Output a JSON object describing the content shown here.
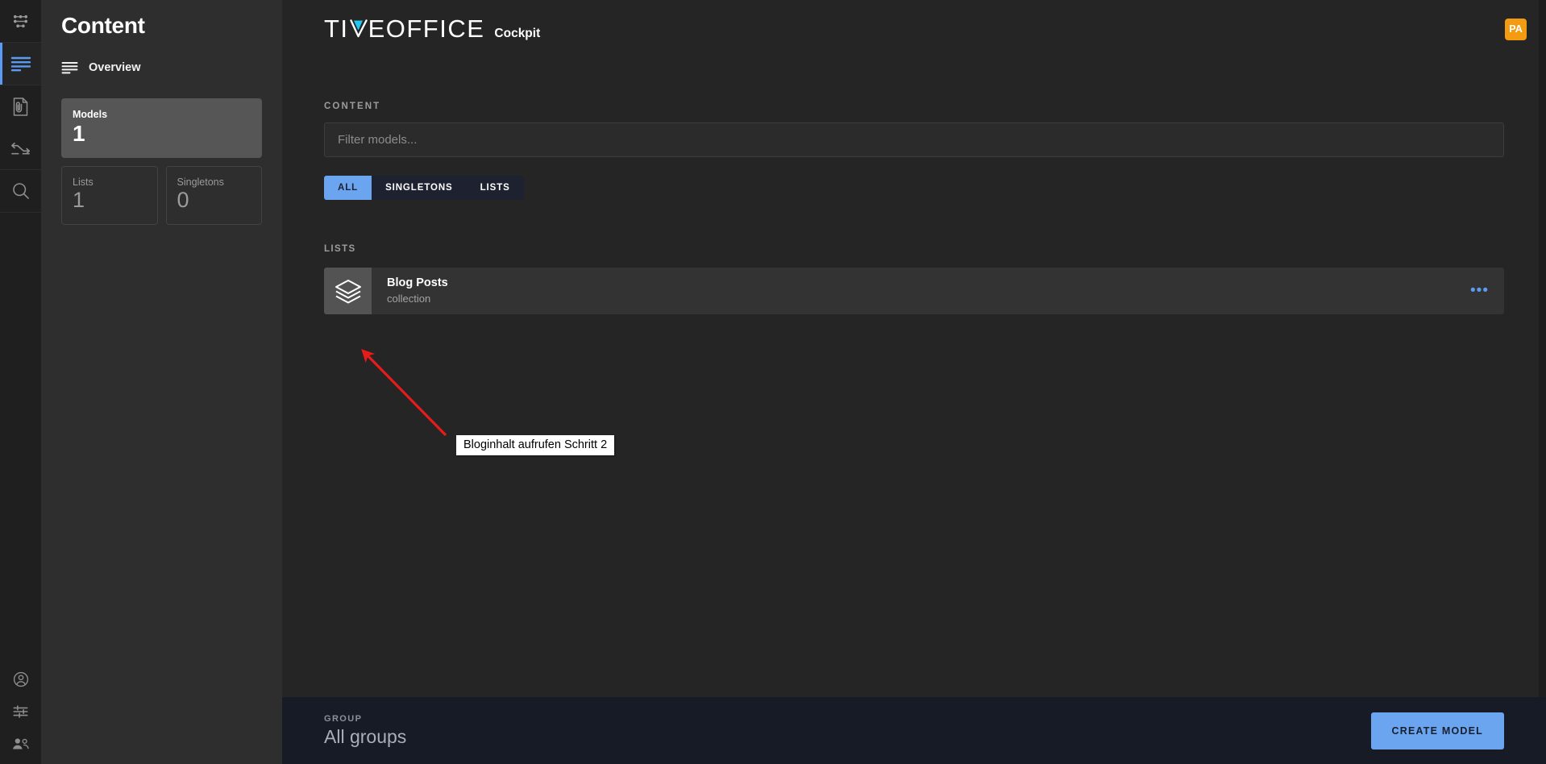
{
  "app": {
    "logo_part1": "TI",
    "logo_part2": "EOFFICE",
    "logo_subtitle": "Cockpit",
    "avatar_initials": "PA"
  },
  "rail": {
    "items": [
      {
        "name": "nodes-icon",
        "label": "Nodes"
      },
      {
        "name": "content-lines-icon",
        "label": "Content"
      },
      {
        "name": "file-attachment-icon",
        "label": "Assets"
      },
      {
        "name": "sync-arrows-icon",
        "label": "Sync"
      },
      {
        "name": "search-icon",
        "label": "Search"
      }
    ],
    "bottom_items": [
      {
        "name": "account-circle-icon",
        "label": "Account"
      },
      {
        "name": "settings-sliders-icon",
        "label": "Settings"
      },
      {
        "name": "users-people-icon",
        "label": "Users"
      }
    ]
  },
  "sidebar": {
    "title": "Content",
    "nav": {
      "label": "Overview",
      "icon": "list-lines-icon"
    },
    "stats": {
      "primary": {
        "label": "Models",
        "value": "1"
      },
      "secondary": [
        {
          "label": "Lists",
          "value": "1"
        },
        {
          "label": "Singletons",
          "value": "0"
        }
      ]
    }
  },
  "main": {
    "section_label": "CONTENT",
    "filter_placeholder": "Filter models...",
    "filter_value": "",
    "tabs": [
      {
        "label": "ALL",
        "active": true
      },
      {
        "label": "SINGLETONS",
        "active": false
      },
      {
        "label": "LISTS",
        "active": false
      }
    ],
    "lists_label": "LISTS",
    "models": [
      {
        "name": "Blog Posts",
        "type": "collection",
        "icon": "layers-stack-icon",
        "menu": "•••"
      }
    ]
  },
  "footer": {
    "group_label": "GROUP",
    "group_value": "All groups",
    "create_button": "CREATE MODEL"
  },
  "annotation": {
    "text": "Bloginhalt aufrufen Schritt 2",
    "arrow_color": "#e81b1b"
  }
}
